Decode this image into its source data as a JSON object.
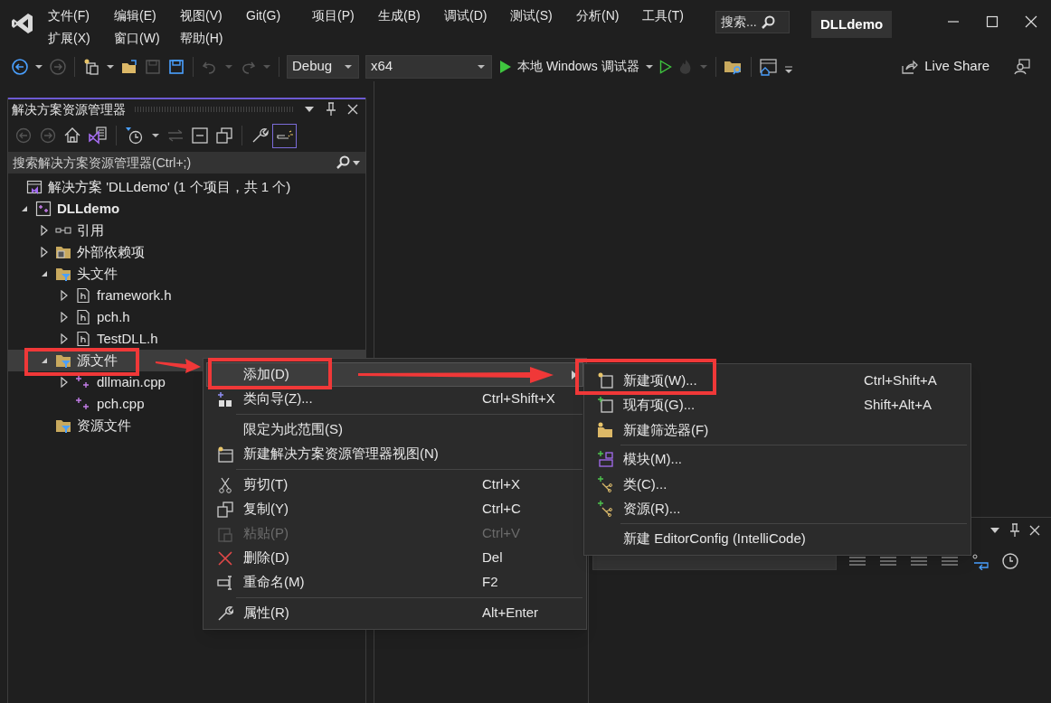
{
  "menu_bar": [
    "文件(F)",
    "编辑(E)",
    "视图(V)",
    "Git(G)",
    "项目(P)",
    "生成(B)",
    "调试(D)",
    "测试(S)",
    "分析(N)",
    "工具(T)",
    "扩展(X)",
    "窗口(W)",
    "帮助(H)"
  ],
  "search": {
    "placeholder": "搜索..."
  },
  "title": "DLLdemo",
  "toolbar": {
    "configuration": "Debug",
    "platform": "x64",
    "run": "本地 Windows 调试器",
    "live_share": "Live Share"
  },
  "solution_explorer": {
    "title": "解决方案资源管理器",
    "search": {
      "placeholder": "搜索解决方案资源管理器(Ctrl+;)"
    },
    "tree": [
      {
        "label": "解决方案 'DLLdemo' (1 个项目，共 1 个)",
        "kind": "solution",
        "selected": false
      },
      {
        "label": "DLLdemo",
        "kind": "project",
        "expanded": true,
        "selected": false,
        "children": [
          {
            "label": "引用",
            "kind": "references",
            "expanded": false,
            "selected": false
          },
          {
            "label": "外部依赖项",
            "kind": "dependencies",
            "expanded": false,
            "selected": false
          },
          {
            "label": "头文件",
            "kind": "filter",
            "expanded": true,
            "selected": false,
            "children": [
              {
                "label": "framework.h",
                "kind": "header",
                "expanded": false,
                "selected": false
              },
              {
                "label": "pch.h",
                "kind": "header",
                "expanded": false,
                "selected": false
              },
              {
                "label": "TestDLL.h",
                "kind": "header",
                "expanded": false,
                "selected": false
              }
            ]
          },
          {
            "label": "源文件",
            "kind": "filter",
            "expanded": true,
            "selected": true,
            "children": [
              {
                "label": "dllmain.cpp",
                "kind": "cpp",
                "expanded": false,
                "selected": false
              },
              {
                "label": "pch.cpp",
                "kind": "cpp",
                "selected": false
              }
            ]
          },
          {
            "label": "资源文件",
            "kind": "filter",
            "selected": false
          }
        ]
      }
    ]
  },
  "context_menu": [
    {
      "kind": "item",
      "label": "添加(D)",
      "selected": true,
      "disabled": false,
      "submenu": true
    },
    {
      "kind": "item",
      "label": "类向导(Z)...",
      "shortcut": "Ctrl+Shift+X",
      "selected": false,
      "disabled": false,
      "submenu": false
    },
    {
      "kind": "separator"
    },
    {
      "kind": "item",
      "label": "限定为此范围(S)",
      "selected": false,
      "disabled": false,
      "submenu": false
    },
    {
      "kind": "item",
      "label": "新建解决方案资源管理器视图(N)",
      "selected": false,
      "disabled": false,
      "submenu": false
    },
    {
      "kind": "separator"
    },
    {
      "kind": "item",
      "label": "剪切(T)",
      "shortcut": "Ctrl+X",
      "selected": false,
      "disabled": false,
      "submenu": false
    },
    {
      "kind": "item",
      "label": "复制(Y)",
      "shortcut": "Ctrl+C",
      "selected": false,
      "disabled": false,
      "submenu": false
    },
    {
      "kind": "item",
      "label": "粘贴(P)",
      "shortcut": "Ctrl+V",
      "selected": false,
      "disabled": true,
      "submenu": false
    },
    {
      "kind": "item",
      "label": "删除(D)",
      "shortcut": "Del",
      "selected": false,
      "disabled": false,
      "submenu": false
    },
    {
      "kind": "item",
      "label": "重命名(M)",
      "shortcut": "F2",
      "selected": false,
      "disabled": false,
      "submenu": false
    },
    {
      "kind": "separator"
    },
    {
      "kind": "item",
      "label": "属性(R)",
      "shortcut": "Alt+Enter",
      "selected": false,
      "disabled": false,
      "submenu": false
    }
  ],
  "submenu": [
    {
      "kind": "item",
      "label": "新建项(W)...",
      "shortcut": "Ctrl+Shift+A"
    },
    {
      "kind": "item",
      "label": "现有项(G)...",
      "shortcut": "Shift+Alt+A"
    },
    {
      "kind": "item",
      "label": "新建筛选器(F)"
    },
    {
      "kind": "separator"
    },
    {
      "kind": "item",
      "label": "模块(M)..."
    },
    {
      "kind": "item",
      "label": "类(C)..."
    },
    {
      "kind": "item",
      "label": "资源(R)..."
    },
    {
      "kind": "separator"
    },
    {
      "kind": "item",
      "label": "新建 EditorConfig (IntelliCode)"
    }
  ]
}
